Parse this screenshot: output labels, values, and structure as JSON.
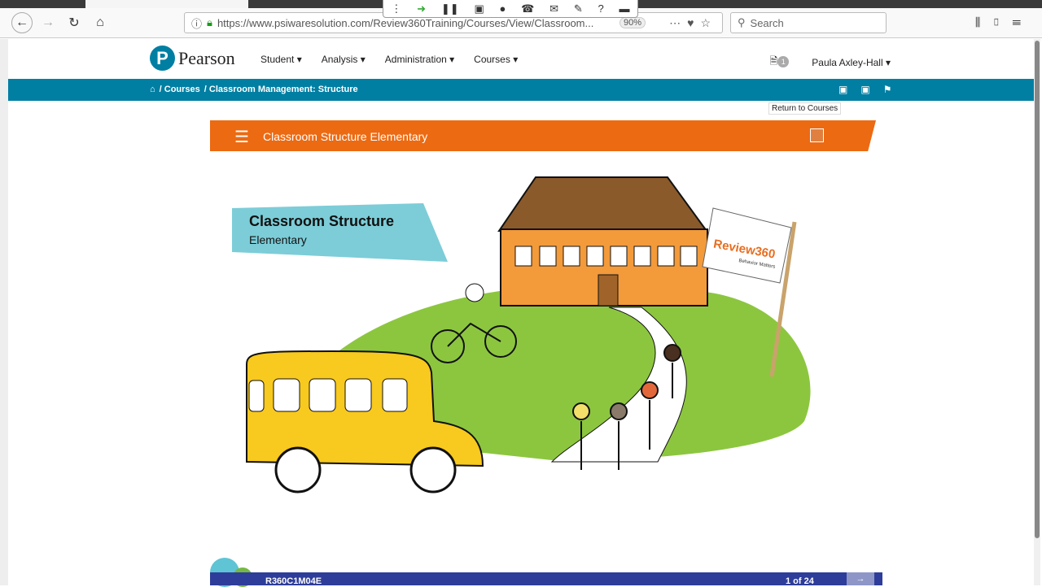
{
  "browser": {
    "url": "https://www.psiwaresolution.com/Review360Training/Courses/View/Classroom...",
    "zoom": "90%",
    "search_placeholder": "Search"
  },
  "header": {
    "logo": "Pearson",
    "menu": [
      {
        "label": "Student ▾"
      },
      {
        "label": "Analysis ▾"
      },
      {
        "label": "Administration ▾"
      },
      {
        "label": "Courses ▾"
      }
    ],
    "notifications": "1",
    "user": "Paula Axley-Hall ▾"
  },
  "breadcrumb": {
    "items": [
      "/ Courses",
      "/ Classroom Management: Structure"
    ]
  },
  "tooltip": "Return to Courses",
  "player": {
    "title": "Classroom Structure Elementary",
    "slide_title": "Classroom Structure",
    "slide_subtitle": "Elementary",
    "flag_text": "Review360",
    "flag_sub": "Behavior Matters",
    "code": "R360C1M04E",
    "page": "1 of 24"
  },
  "colors": {
    "brand": "#007fa3",
    "header_bar": "#ec6a12",
    "footer_bar": "#2e3d99"
  }
}
